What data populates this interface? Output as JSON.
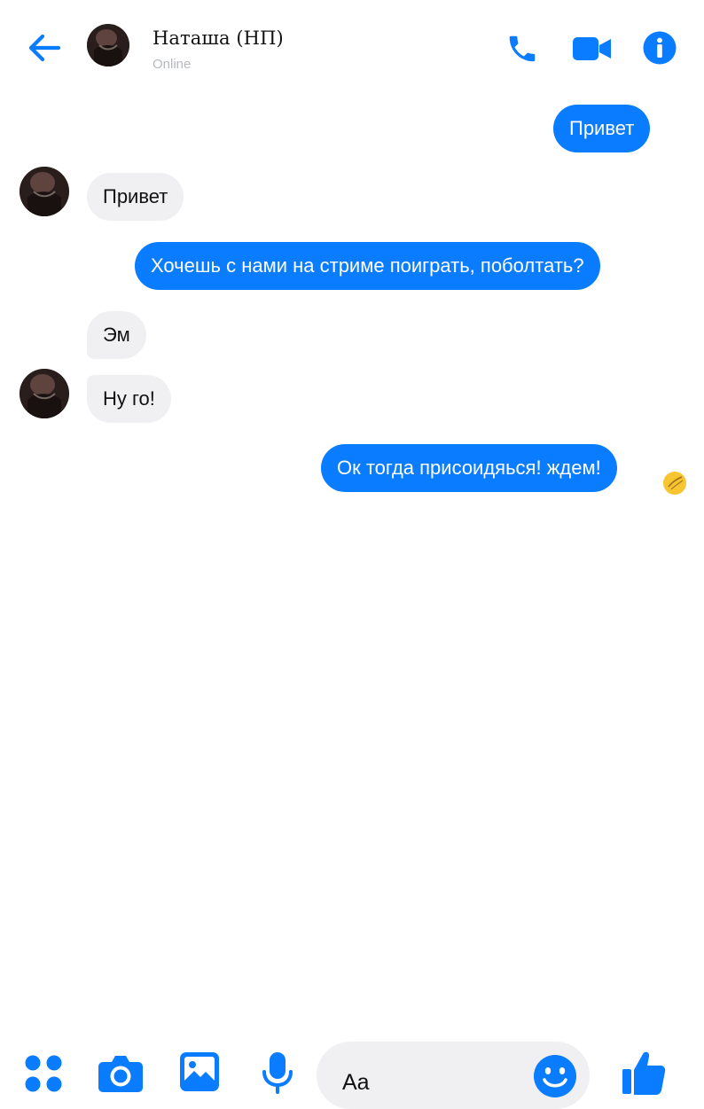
{
  "header": {
    "back_icon": "arrow-left-icon",
    "contact_name": "Наташа (НП)",
    "contact_status": "Online",
    "call_icon": "phone-icon",
    "video_icon": "video-camera-icon",
    "info_icon": "info-icon"
  },
  "messages": [
    {
      "direction": "outgoing",
      "text": "Привет"
    },
    {
      "direction": "incoming",
      "text": "Привет"
    },
    {
      "direction": "outgoing",
      "text": "Хочешь с нами на стриме поиграть, поболтать?"
    },
    {
      "direction": "incoming",
      "text": "Эм"
    },
    {
      "direction": "incoming",
      "text": "Ну го!"
    },
    {
      "direction": "outgoing",
      "text": "Ок тогда присоидяься! ждем!"
    }
  ],
  "composer": {
    "placeholder": "Aa",
    "icons": [
      "apps-grid-icon",
      "camera-icon",
      "image-icon",
      "microphone-icon",
      "emoji-icon",
      "thumbs-up-icon"
    ]
  },
  "colors": {
    "accent": "#0a7cff",
    "incoming_bubble": "#f0f0f2",
    "status_text": "#b6b9bd"
  }
}
